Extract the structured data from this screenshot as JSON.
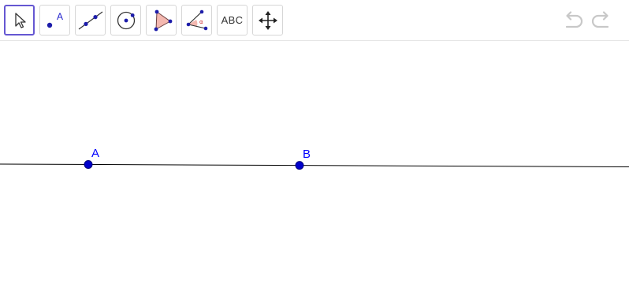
{
  "toolbar": {
    "tools": [
      {
        "name": "move",
        "icon": "cursor-arrow-icon",
        "active": true
      },
      {
        "name": "point",
        "icon": "point-icon",
        "icon_label": "A"
      },
      {
        "name": "line",
        "icon": "line-through-two-points-icon"
      },
      {
        "name": "circle",
        "icon": "circle-center-point-icon"
      },
      {
        "name": "polygon",
        "icon": "polygon-icon"
      },
      {
        "name": "angle",
        "icon": "angle-icon",
        "icon_label": "α"
      },
      {
        "name": "text",
        "icon": "text-icon",
        "label": "ABC"
      },
      {
        "name": "move-graphics-view",
        "icon": "move-arrows-icon"
      }
    ],
    "undo_icon": "undo-icon",
    "redo_icon": "redo-icon"
  },
  "graphics": {
    "points": [
      {
        "label": "A"
      },
      {
        "label": "B"
      }
    ]
  },
  "colors": {
    "active_tool_border": "#6557d2",
    "point_fill": "#0000cc",
    "label": "#0000ff",
    "line": "#000000",
    "polygon_fill": "#f4b8b0",
    "angle_fill": "#f4b8b0",
    "undo_redo": "#cccccc"
  }
}
